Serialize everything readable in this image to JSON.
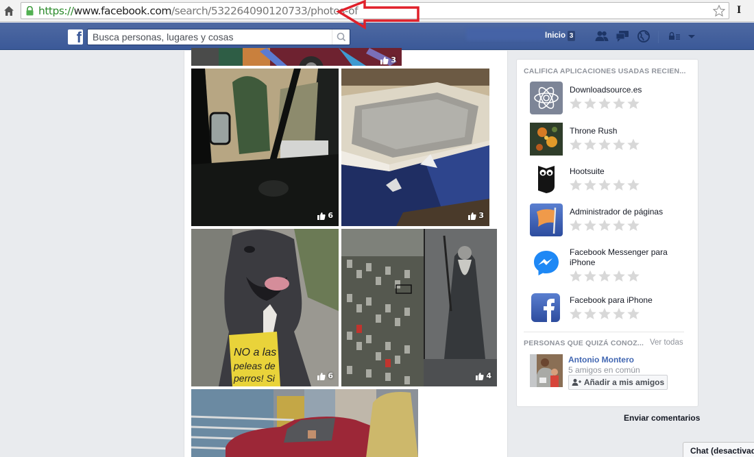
{
  "browser": {
    "url_protocol": "https://",
    "url_host": "www.facebook.com",
    "url_path": "/search/532264090120733/photos-of",
    "home_icon": "home-icon",
    "bookmark_icon": "star-outline-icon",
    "extension_label": "I"
  },
  "topbar": {
    "logo": "f",
    "search_placeholder": "Busca personas, lugares y cosas",
    "search_value": "",
    "home_label": "Inicio",
    "home_count": "3",
    "icons": [
      "friend-requests-icon",
      "messages-icon",
      "notifications-globe-icon",
      "privacy-shortcuts-icon",
      "account-menu-chevron-icon"
    ],
    "brand_color": "#3b5998"
  },
  "photos": [
    {
      "description": "colorful mural and car (partially scrolled)",
      "likes": "3"
    },
    {
      "description": "view from car window",
      "likes": "6"
    },
    {
      "description": "opened box with console",
      "likes": "3"
    },
    {
      "description": "dog with sign",
      "likes": "6",
      "sign_text": "NO a las peleas de perros! Si quiere..."
    },
    {
      "description": "traffic jam and wizard collage",
      "likes": "4"
    },
    {
      "description": "red car crashed into building",
      "likes": ""
    }
  ],
  "sidebar": {
    "apps_title": "CALIFICA APLICACIONES USADAS RECIEN...",
    "apps": [
      {
        "name": "Downloadsource.es",
        "icon": "atom-icon",
        "rating": 0,
        "max_rating": 5
      },
      {
        "name": "Throne Rush",
        "icon": "throne-rush-game-icon",
        "rating": 0,
        "max_rating": 5
      },
      {
        "name": "Hootsuite",
        "icon": "owl-icon",
        "rating": 0,
        "max_rating": 5
      },
      {
        "name": "Administrador de páginas",
        "icon": "flag-icon",
        "rating": 0,
        "max_rating": 5
      },
      {
        "name": "Facebook Messenger para iPhone",
        "icon": "messenger-icon",
        "rating": 0,
        "max_rating": 5
      },
      {
        "name": "Facebook para iPhone",
        "icon": "facebook-icon",
        "rating": 0,
        "max_rating": 5
      }
    ],
    "people_title": "PERSONAS QUE QUIZÁ CONOZ...",
    "see_all": "Ver todas",
    "person": {
      "name": "Antonio Montero",
      "mutual": "5 amigos en común",
      "add_button": "Añadir a mis amigos"
    }
  },
  "footer": {
    "feedback": "Enviar comentarios",
    "chat": "Chat (desactivado)"
  }
}
